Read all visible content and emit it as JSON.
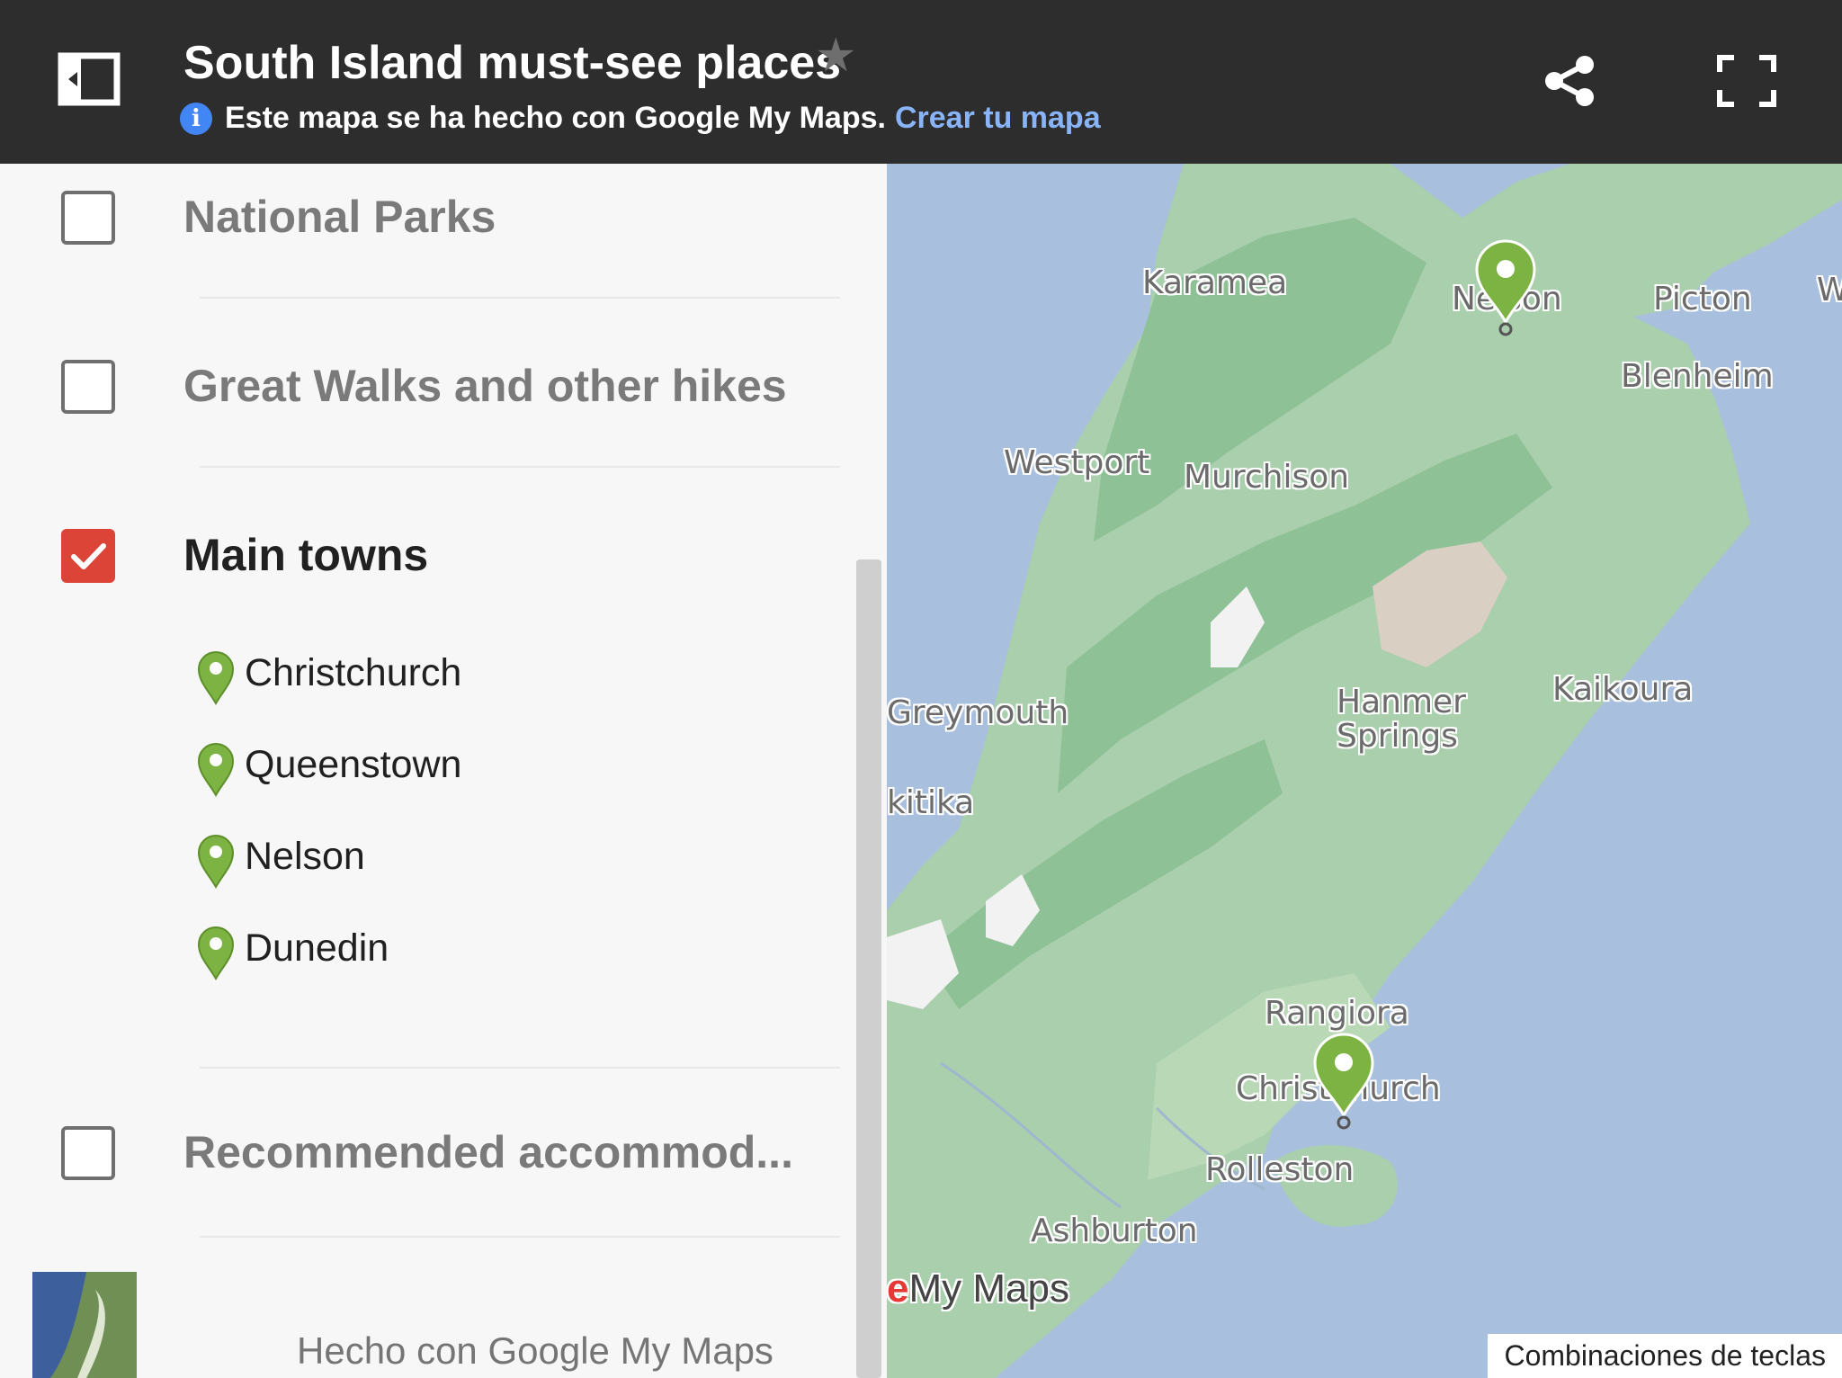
{
  "header": {
    "title": "South Island must-see places",
    "info_text": "Este mapa se ha hecho con Google My Maps.",
    "info_link": "Crear tu mapa"
  },
  "layers": [
    {
      "name": "National Parks",
      "checked": false
    },
    {
      "name": "Great Walks and other hikes",
      "checked": false
    },
    {
      "name": "Main towns",
      "checked": true,
      "items": [
        "Christchurch",
        "Queenstown",
        "Nelson",
        "Dunedin"
      ]
    },
    {
      "name": "Recommended accommod...",
      "checked": false
    }
  ],
  "footer": {
    "text": "Hecho con Google My Maps"
  },
  "map": {
    "labels": {
      "karamea": "Karamea",
      "nelson": "Nelson",
      "picton": "Picton",
      "w": "W",
      "blenheim": "Blenheim",
      "westport": "Westport",
      "murchison": "Murchison",
      "greymouth": "Greymouth",
      "hanmer1": "Hanmer",
      "hanmer2": "Springs",
      "kaikoura": "Kaikoura",
      "hokitika": "kitika",
      "rangiora": "Rangiora",
      "christchurch": "Christchurch",
      "rolleston": "Rolleston",
      "ashburton": "Ashburton"
    },
    "watermark_g": "e",
    "watermark": "My Maps",
    "shortcuts": "Combinaciones de teclas"
  },
  "colors": {
    "header_bg": "#2d2d2d",
    "checkbox_checked": "#db4437",
    "pin_green": "#7cb342",
    "water": "#a8bfde",
    "land": "#a9cfac",
    "link": "#8ab4f8"
  },
  "icons": [
    "panel-toggle-icon",
    "star-icon",
    "info-icon",
    "share-icon",
    "fullscreen-icon",
    "checkbox-icon",
    "map-pin-icon"
  ]
}
